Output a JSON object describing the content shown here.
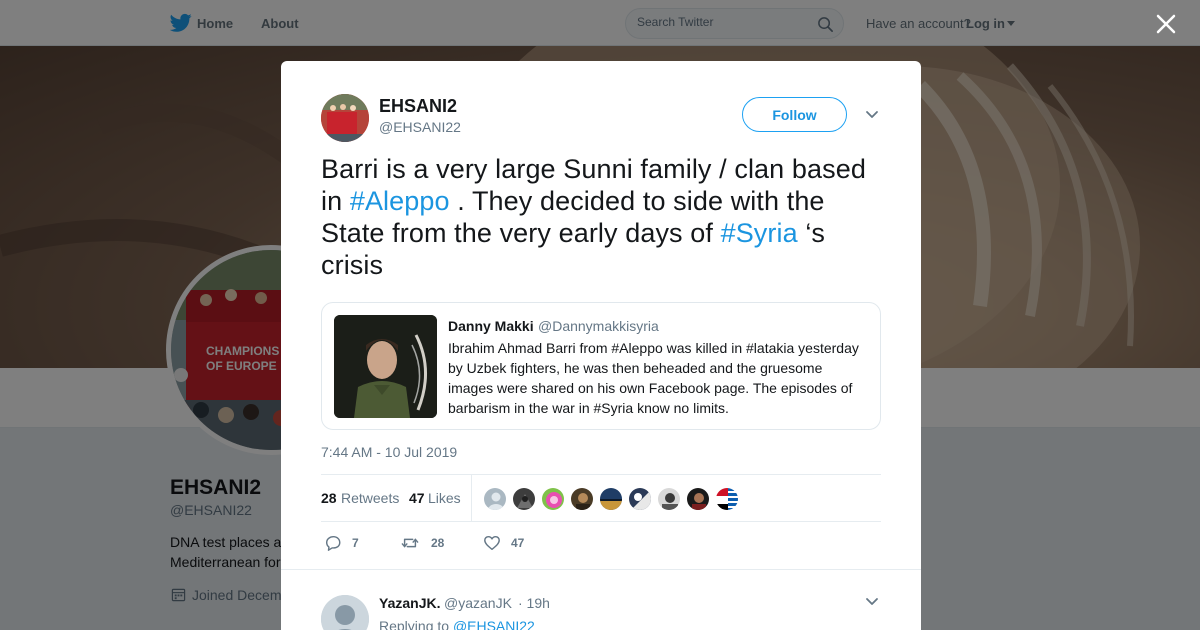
{
  "topnav": {
    "home_label": "Home",
    "about_label": "About",
    "search_placeholder": "Search Twitter",
    "have_account": "Have an account?",
    "login_label": "Log in"
  },
  "background_profile": {
    "name": "EHSANI2",
    "handle": "@EHSANI22",
    "bio_line1": "DNA test places a",
    "bio_line2": "Mediterranean for",
    "joined": "Joined Decem"
  },
  "tweet": {
    "author_name": "EHSANI2",
    "author_handle": "@EHSANI22",
    "follow_label": "Follow",
    "text_part1": "Barri is a very large Sunni family / clan based in ",
    "hashtag1": "#Aleppo",
    "text_part2": " . They decided to side with the State from the very early days of ",
    "hashtag2": "#Syria",
    "text_part3": " ‘s crisis",
    "timestamp": "7:44 AM - 10 Jul 2019",
    "quoted": {
      "name": "Danny Makki",
      "handle": "@Dannymakkisyria",
      "text": "Ibrahim Ahmad Barri from #Aleppo was killed in #latakia yesterday by Uzbek fighters, he was then beheaded and the gruesome images were shared on his own Facebook page. The episodes of barbarism in the war in #Syria know no limits."
    },
    "stats": {
      "retweets_count": "28",
      "retweets_label": "Retweets",
      "likes_count": "47",
      "likes_label": "Likes"
    },
    "actions": {
      "reply_count": "7",
      "retweet_count": "28",
      "like_count": "47"
    }
  },
  "reply": {
    "name": "YazanJK.",
    "handle": "@yazanJK",
    "time": "· 19h",
    "replying_to_label": "Replying to",
    "replying_to_handle": "@EHSANI22"
  },
  "colors": {
    "accent": "#1da1f2",
    "link": "#1b95e0",
    "secondary_text": "#657786"
  }
}
